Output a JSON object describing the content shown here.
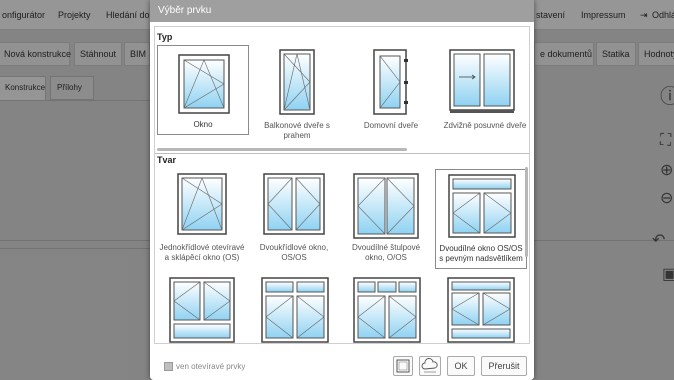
{
  "app": {
    "nav": [
      "onfigurátor",
      "Projekty",
      "Hledání dok",
      "stavení",
      "Impressum",
      "Odhlá"
    ],
    "toolbar": [
      "Nová konstrukce",
      "Stáhnout",
      "BIM",
      "e dokumentů",
      "Statika",
      "Hodnoty"
    ],
    "tabs": [
      "Konstrukce",
      "Přílohy"
    ]
  },
  "dialog": {
    "title": "Výběr prvku",
    "typ_title": "Typ",
    "tvar_title": "Tvar",
    "typ_items": [
      {
        "label": "Okno",
        "icon": "window-tilt-turn-icon",
        "selected": true
      },
      {
        "label": "Balkonové dveře s prahem",
        "icon": "balcony-door-icon"
      },
      {
        "label": "Domovní dveře",
        "icon": "entrance-door-icon"
      },
      {
        "label": "Zdvižně posuvné dveře",
        "icon": "lift-slide-door-icon"
      }
    ],
    "tvar_items": [
      {
        "label": "Jednokřídlové otevíravé a sklápěcí okno (OS)",
        "icon": "single-sash-window-icon"
      },
      {
        "label": "Dvoukřídlové okno, OS/OS",
        "icon": "double-sash-window-icon"
      },
      {
        "label": "Dvoudílné štulpové okno, O/OS",
        "icon": "french-window-icon"
      },
      {
        "label": "Dvoudílné okno OS/OS s pevným nadsvětlíkem",
        "icon": "window-with-transom-icon",
        "selected": true
      },
      {
        "label": "",
        "icon": "window-with-bottom-light-icon"
      },
      {
        "label": "",
        "icon": "window-with-transom-split-icon"
      },
      {
        "label": "",
        "icon": "window-with-three-transoms-icon"
      },
      {
        "label": "",
        "icon": "window-with-transom-and-bottom-icon"
      }
    ],
    "footer": {
      "checkbox_label": "ven otevíravé prvky",
      "ok": "OK",
      "cancel": "Přerušit"
    }
  }
}
